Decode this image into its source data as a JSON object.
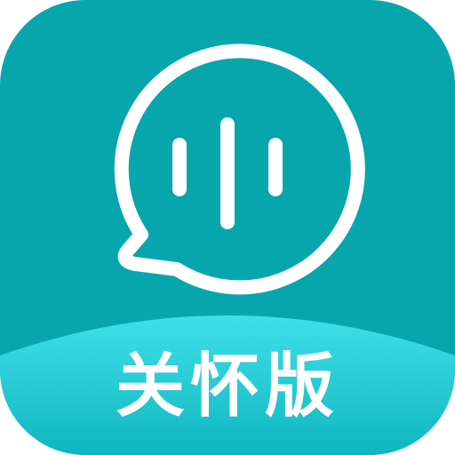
{
  "app_icon": {
    "edition_label": "关怀版",
    "icon_name": "voice-chat-bubble-icon",
    "colors": {
      "background": "#07a6ac",
      "band_light": "#3fe1e8",
      "band_dark": "#0fb6bf",
      "foreground": "#ffffff"
    }
  }
}
